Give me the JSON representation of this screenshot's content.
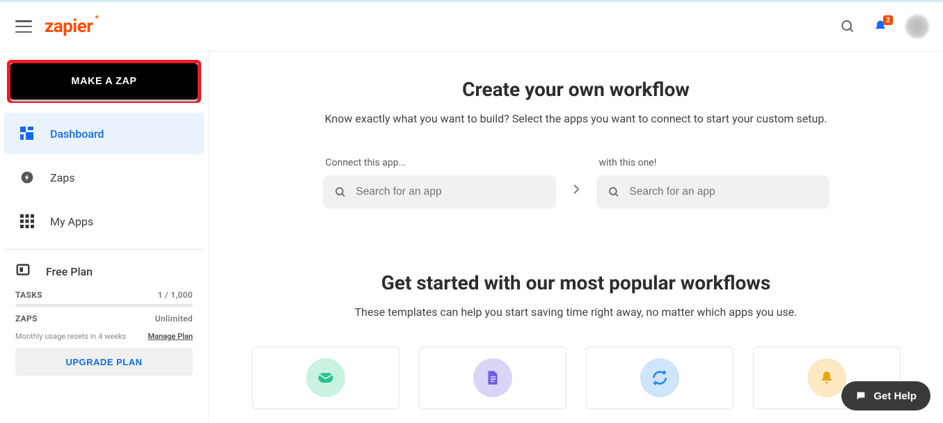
{
  "header": {
    "logo_text": "zapier",
    "notification_count": "2"
  },
  "sidebar": {
    "make_zap_label": "MAKE A ZAP",
    "nav": [
      {
        "label": "Dashboard"
      },
      {
        "label": "Zaps"
      },
      {
        "label": "My Apps"
      }
    ],
    "plan": {
      "title": "Free Plan",
      "tasks_label": "TASKS",
      "tasks_value": "1 / 1,000",
      "zaps_label": "ZAPS",
      "zaps_value": "Unlimited",
      "reset_text": "Monthly usage resets in 4 weeks",
      "manage_text": "Manage Plan",
      "upgrade_label": "UPGRADE PLAN"
    }
  },
  "main": {
    "title": "Create your own workflow",
    "subtitle": "Know exactly what you want to build? Select the apps you want to connect to start your custom setup.",
    "connect_label_1": "Connect this app...",
    "connect_label_2": "with this one!",
    "search_placeholder": "Search for an app",
    "popular_title": "Get started with our most popular workflows",
    "popular_subtitle": "These templates can help you start saving time right away, no matter which apps you use."
  },
  "footer": {
    "get_help_label": "Get Help"
  }
}
